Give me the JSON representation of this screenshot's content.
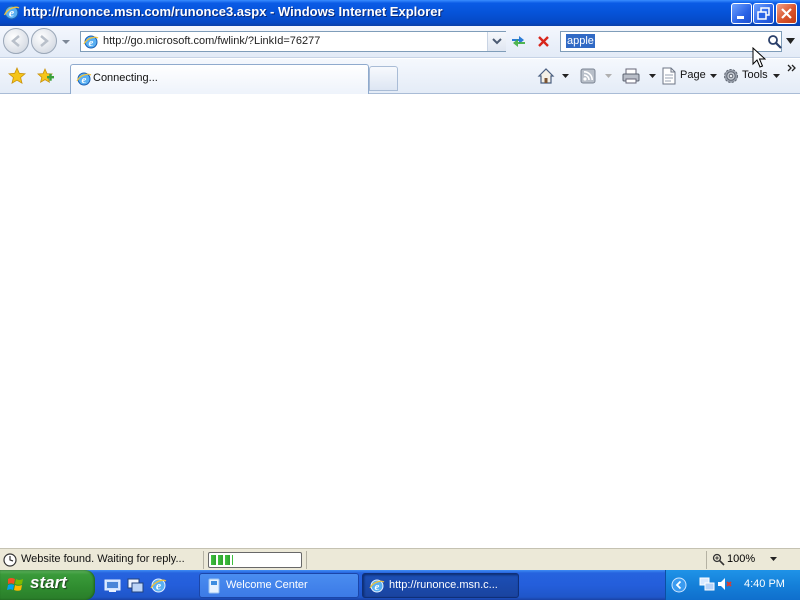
{
  "window": {
    "title": "http://runonce.msn.com/runonce3.aspx - Windows Internet Explorer"
  },
  "address_bar": {
    "url": "http://go.microsoft.com/fwlink/?LinkId=76277"
  },
  "search": {
    "query": "apple"
  },
  "tabs": [
    {
      "label": "Connecting..."
    }
  ],
  "commands": {
    "page_label": "Page",
    "tools_label": "Tools"
  },
  "status_bar": {
    "text": "Website found. Waiting for reply...",
    "progress_percent": 25,
    "zoom": "100%"
  },
  "taskbar": {
    "start_label": "start",
    "tasks": [
      {
        "label": "Welcome Center"
      },
      {
        "label": "http://runonce.msn.c..."
      }
    ],
    "clock": "4:40 PM"
  },
  "icons": {
    "title": "ie-logo-icon",
    "back": "back-arrow-icon",
    "forward": "forward-arrow-icon",
    "refresh": "refresh-icon",
    "stop": "stop-x-icon",
    "search": "magnifier-icon",
    "favorites": "star-icon",
    "add_favorites": "star-plus-icon",
    "home": "home-icon",
    "feeds": "rss-icon",
    "print": "printer-icon",
    "page": "page-icon",
    "tools": "gear-icon"
  },
  "colors": {
    "titlebar": "#0653d8",
    "taskbar": "#245edb",
    "start_button": "#3a9a3a",
    "progress": "#2fa02f"
  }
}
